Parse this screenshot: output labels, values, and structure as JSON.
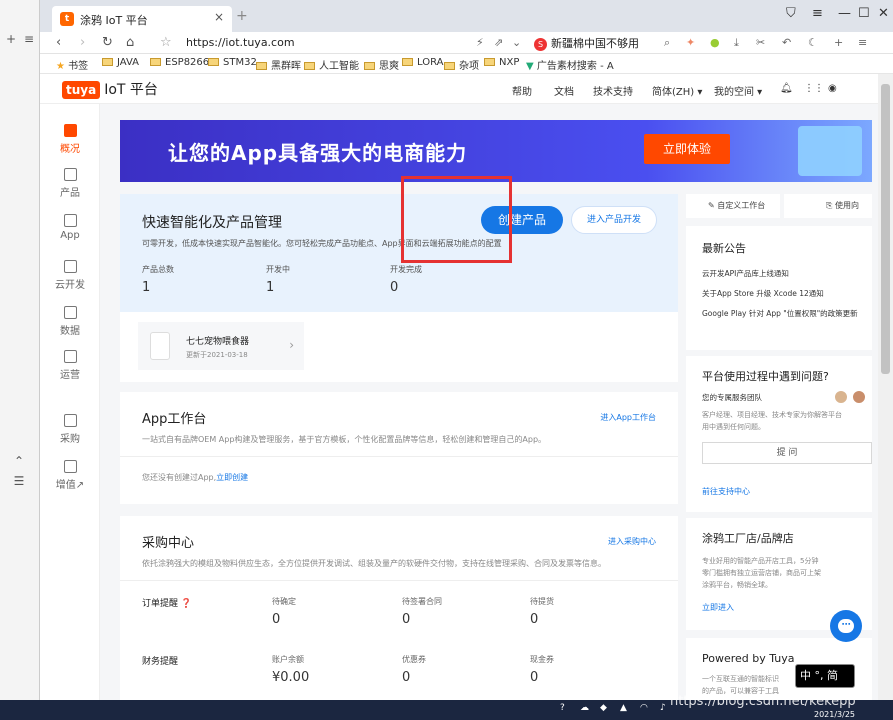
{
  "tab": {
    "title": "涂鸦 IoT 平台",
    "favicon": "t",
    "close": "×",
    "new": "+"
  },
  "window_controls": {
    "shield": "⛉",
    "menu": "≡",
    "minimize": "—",
    "maximize": "☐",
    "close": "✕"
  },
  "address": {
    "url": "https://iot.tuya.com",
    "search_hint": "新疆棉中国不够用"
  },
  "bookmarks": [
    "书签",
    "JAVA",
    "ESP8266",
    "STM32",
    "黑群晖",
    "人工智能",
    "思爽",
    "LORA",
    "杂项",
    "NXP",
    "广告素材搜索 - A"
  ],
  "header": {
    "logo_brand": "tuya",
    "logo_title": "IoT 平台",
    "links": [
      "帮助",
      "文档",
      "技术支持",
      "简体(ZH) ▾",
      "我的空间 ▾"
    ]
  },
  "sidebar": {
    "items": [
      {
        "label": "概况"
      },
      {
        "label": "产品"
      },
      {
        "label": "App"
      },
      {
        "label": "云开发"
      },
      {
        "label": "数据"
      },
      {
        "label": "运营"
      },
      {
        "label": "采购"
      },
      {
        "label": "增值↗"
      }
    ]
  },
  "banner": {
    "text": "让您的App具备强大的电商能力",
    "button": "立即体验"
  },
  "quick": {
    "title": "快速智能化及产品管理",
    "desc": "可零开发，低成本快速实现产品智能化。您可轻松完成产品功能点、App界面和云端拓展功能点的配置",
    "create_button": "创建产品",
    "enter_button": "进入产品开发",
    "stats": [
      {
        "label": "产品总数",
        "value": "1"
      },
      {
        "label": "开发中",
        "value": "1"
      },
      {
        "label": "开发完成",
        "value": "0"
      }
    ],
    "product": {
      "name": "七七宠物喂食器",
      "updated": "更新于2021-03-18",
      "arrow": "›"
    }
  },
  "app_workbench": {
    "title": "App工作台",
    "link": "进入App工作台",
    "desc": "一站式自有品牌OEM App构建及管理服务，基于官方模板，个性化配置品牌等信息，轻松创建和管理自己的App。",
    "note": "您还没有创建过App,",
    "note_link": "立即创建"
  },
  "purchase": {
    "title": "采购中心",
    "link": "进入采购中心",
    "desc": "依托涂鸦强大的模组及物料供应生态，全方位提供开发调试、组装及量产的软硬件交付物，支持在线管理采购、合同及发票等信息。",
    "order": {
      "label": "订单提醒 ❓",
      "cols": [
        {
          "label": "待确定",
          "value": "0"
        },
        {
          "label": "待签署合同",
          "value": "0"
        },
        {
          "label": "待提货",
          "value": "0"
        }
      ]
    },
    "finance": {
      "label": "财务提醒",
      "cols": [
        {
          "label": "账户余额",
          "value": "¥0.00"
        },
        {
          "label": "优惠券",
          "value": "0"
        },
        {
          "label": "现金券",
          "value": "0"
        }
      ]
    }
  },
  "right": {
    "tabs": [
      "✎ 自定义工作台",
      "⎘ 使用向"
    ],
    "notice": {
      "title": "最新公告",
      "items": [
        "云开发API产品库上线通知",
        "关于App Store 升级 Xcode 12通知",
        "Google Play 针对 App \"位置权限\"的政策更新"
      ]
    },
    "help": {
      "title": "平台使用过程中遇到问题?",
      "team": "您的专属服务团队",
      "desc1": "客户经理、项目经理、技术专家为你解答平台",
      "desc2": "用中遇到任何问题。",
      "ask": "提 问",
      "link": "前往支持中心"
    },
    "brand": {
      "title": "涂鸦工厂店/品牌店",
      "desc1": "专业好用的智能产品开店工具，5分钟",
      "desc2": "零门槛拥有独立运营店铺，商品可上架",
      "desc3": "涂鸦平台，畅销全球。",
      "link": "立即进入"
    },
    "powered": {
      "title": "Powered by Tuya",
      "desc1": "一个互联互通的智能标识",
      "desc2": "的产品，可以兼容于工具"
    }
  },
  "taskbar": {
    "ime": "中 °, 简",
    "date": "2021/3/25",
    "watermark": "https://blog.csdn.net/kekepp"
  }
}
